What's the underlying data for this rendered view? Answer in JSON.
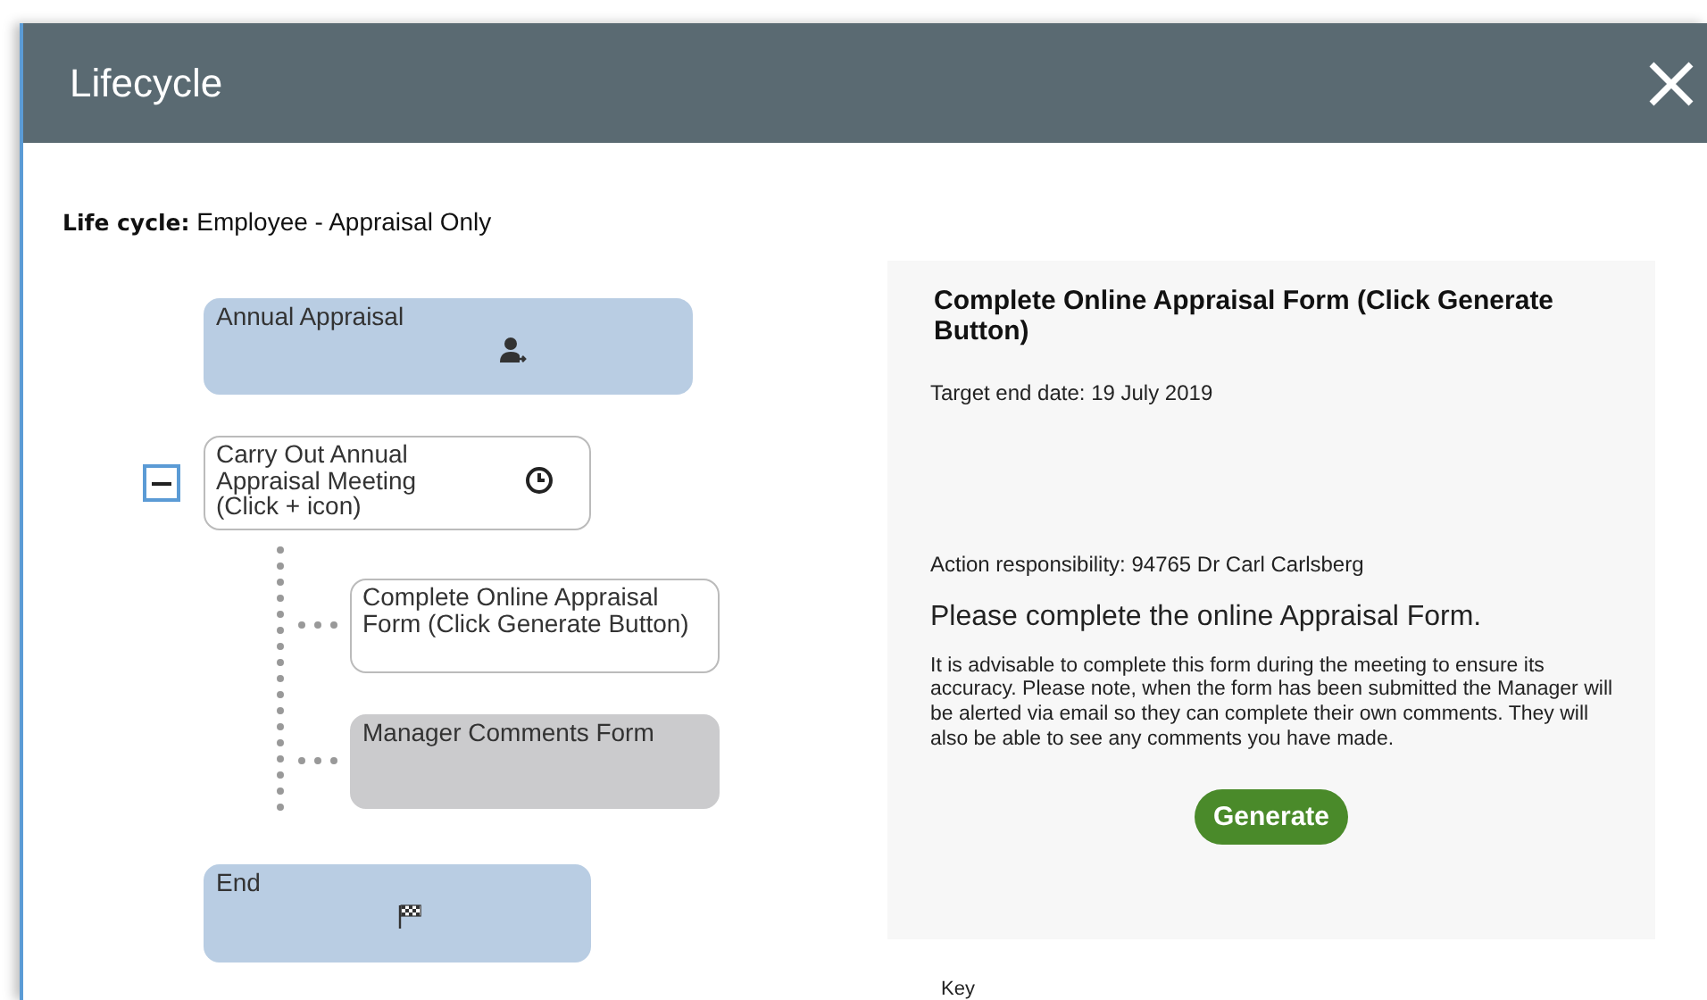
{
  "window": {
    "title": "Lifecycle"
  },
  "lifecycle": {
    "label": "Life cycle:",
    "value": "Employee - Appraisal Only"
  },
  "nodes": [
    {
      "label": "Annual Appraisal",
      "kind": "start",
      "color": "#b9cde3"
    },
    {
      "label": "Carry Out Annual Appraisal Meeting (Click + icon)",
      "kind": "step",
      "color": "#ffffff",
      "expanded": true,
      "children": [
        {
          "label": "Complete Online Appraisal Form (Click Generate Button)",
          "kind": "subtask",
          "color": "#ffffff"
        },
        {
          "label": "Manager Comments Form",
          "kind": "subtask",
          "color": "#cbcbcd"
        }
      ]
    },
    {
      "label": "End",
      "kind": "end",
      "color": "#b9cde3"
    }
  ],
  "detail": {
    "title": "Complete Online Appraisal Form (Click Generate Button)",
    "target_date": "Target end date: 19 July 2019",
    "responsibility": "Action responsibility: 94765 Dr Carl Carlsberg",
    "heading": "Please complete the online Appraisal Form.",
    "body": "It is advisable to complete this form during the meeting to ensure its accuracy. Please note, when the form has been submitted the Manager will be alerted via email so they can complete their own comments. They will also be able to see any comments you have made.",
    "button": "Generate"
  },
  "key": {
    "label": "Key"
  }
}
